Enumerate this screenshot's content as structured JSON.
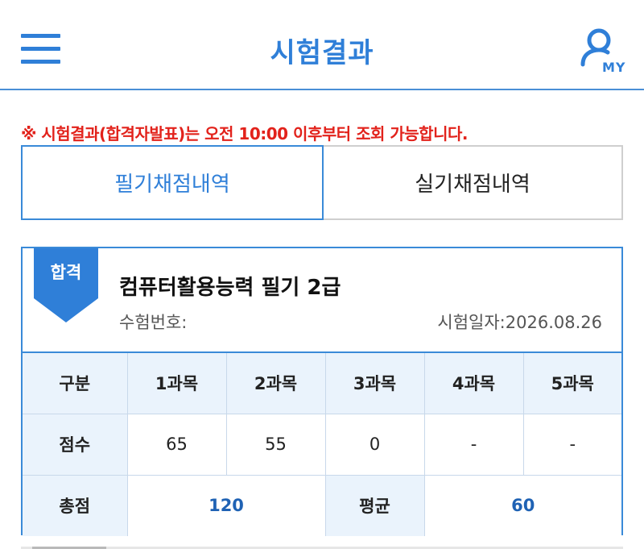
{
  "header": {
    "title": "시험결과",
    "my_label": "MY"
  },
  "notice": "※ 시험결과(합격자발표)는 오전 10:00 이후부터 조회 가능합니다.",
  "tabs": [
    {
      "label": "필기채점내역",
      "active": true
    },
    {
      "label": "실기채점내역",
      "active": false
    }
  ],
  "result": {
    "badge": "합격",
    "exam_name": "컴퓨터활용능력 필기 2급",
    "exam_number_label": "수험번호:",
    "exam_date": "시험일자:2026.08.26",
    "header_row": [
      "구분",
      "1과목",
      "2과목",
      "3과목",
      "4과목",
      "5과목"
    ],
    "score_label": "점수",
    "scores": [
      "65",
      "55",
      "0",
      "-",
      "-"
    ],
    "total_label": "총점",
    "total_value": "120",
    "average_label": "평균",
    "average_value": "60"
  },
  "colors": {
    "accent": "#2f7fd8",
    "notice": "#e2221b",
    "header_cell_bg": "#eaf3fc"
  }
}
